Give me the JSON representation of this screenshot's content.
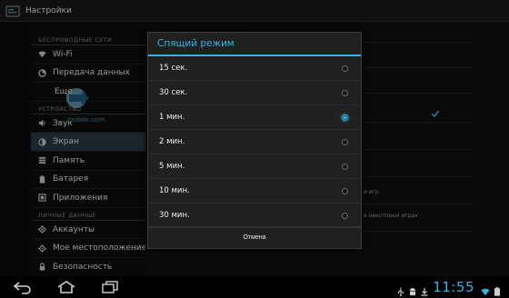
{
  "app": {
    "title": "Настройки"
  },
  "sidebar": {
    "sections": [
      {
        "header": "БЕСПРОВОДНЫЕ СЕТИ",
        "items": [
          {
            "label": "Wi-Fi",
            "icon": "wifi-icon"
          },
          {
            "label": "Передача данных",
            "icon": "data-usage-icon"
          },
          {
            "label": "Еще",
            "icon": "",
            "sub": true
          }
        ]
      },
      {
        "header": "УСТРОЙСТВО",
        "items": [
          {
            "label": "Звук",
            "icon": "sound-icon"
          },
          {
            "label": "Экран",
            "icon": "display-icon",
            "selected": true
          },
          {
            "label": "Память",
            "icon": "storage-icon"
          },
          {
            "label": "Батарея",
            "icon": "battery-icon"
          },
          {
            "label": "Приложения",
            "icon": "apps-icon"
          }
        ]
      },
      {
        "header": "ЛИЧНЫЕ ДАННЫЕ",
        "items": [
          {
            "label": "Аккаунты",
            "icon": "accounts-icon"
          },
          {
            "label": "Мое местоположение",
            "icon": "location-icon"
          },
          {
            "label": "Безопасность",
            "icon": "lock-icon"
          }
        ]
      }
    ]
  },
  "right_pane": {
    "fragments": [
      "и игр",
      "в некоторых играх"
    ]
  },
  "watermark": {
    "text": "mobile.com"
  },
  "dialog": {
    "title": "Спящий режим",
    "options": [
      {
        "label": "15 сек.",
        "checked": false
      },
      {
        "label": "30 сек.",
        "checked": false
      },
      {
        "label": "1 мин.",
        "checked": true
      },
      {
        "label": "2 мин.",
        "checked": false
      },
      {
        "label": "5 мин.",
        "checked": false
      },
      {
        "label": "10 мин.",
        "checked": false
      },
      {
        "label": "30 мин.",
        "checked": false
      }
    ],
    "cancel_label": "Отмена"
  },
  "system_bar": {
    "clock": "11:55"
  },
  "colors": {
    "accent": "#33b5e5",
    "selected_row": "#2b3a44"
  }
}
